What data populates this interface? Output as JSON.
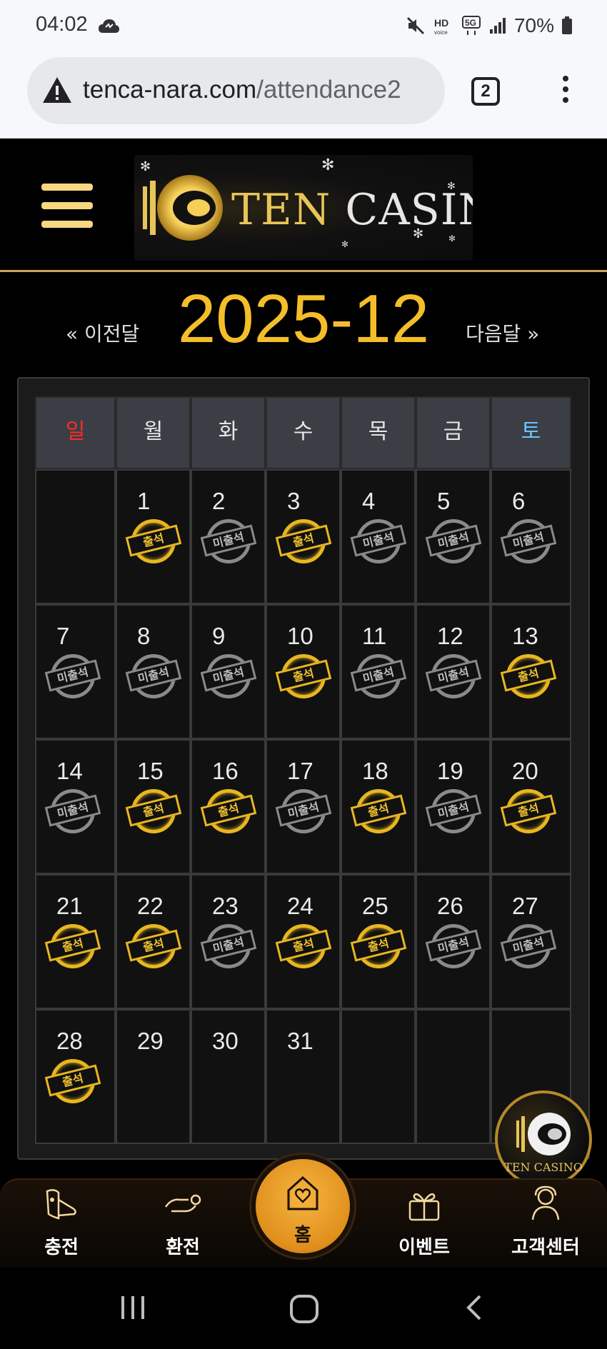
{
  "status_bar": {
    "time": "04:02",
    "battery": "70%",
    "icons": [
      "mute-icon",
      "hd-voice-icon",
      "5g-icon",
      "signal-icon",
      "battery-icon"
    ]
  },
  "browser": {
    "url_domain": "tenca-nara.com",
    "url_path": "/attendance2",
    "tab_count": "2"
  },
  "header": {
    "logo_ten": "TEN",
    "logo_casino": "CASINO"
  },
  "month_nav": {
    "prev_label": "« 이전달",
    "title": "2025-12",
    "next_label": "다음달 »"
  },
  "calendar": {
    "weekdays": [
      "일",
      "월",
      "화",
      "수",
      "목",
      "금",
      "토"
    ],
    "attend_label": "출석",
    "absent_label": "미출석",
    "weeks": [
      [
        {
          "day": "",
          "status": ""
        },
        {
          "day": "1",
          "status": "attend"
        },
        {
          "day": "2",
          "status": "absent"
        },
        {
          "day": "3",
          "status": "attend"
        },
        {
          "day": "4",
          "status": "absent"
        },
        {
          "day": "5",
          "status": "absent"
        },
        {
          "day": "6",
          "status": "absent"
        }
      ],
      [
        {
          "day": "7",
          "status": "absent"
        },
        {
          "day": "8",
          "status": "absent"
        },
        {
          "day": "9",
          "status": "absent"
        },
        {
          "day": "10",
          "status": "attend"
        },
        {
          "day": "11",
          "status": "absent"
        },
        {
          "day": "12",
          "status": "absent"
        },
        {
          "day": "13",
          "status": "attend"
        }
      ],
      [
        {
          "day": "14",
          "status": "absent"
        },
        {
          "day": "15",
          "status": "attend"
        },
        {
          "day": "16",
          "status": "attend"
        },
        {
          "day": "17",
          "status": "absent"
        },
        {
          "day": "18",
          "status": "attend"
        },
        {
          "day": "19",
          "status": "absent"
        },
        {
          "day": "20",
          "status": "attend"
        }
      ],
      [
        {
          "day": "21",
          "status": "attend"
        },
        {
          "day": "22",
          "status": "attend"
        },
        {
          "day": "23",
          "status": "absent"
        },
        {
          "day": "24",
          "status": "attend"
        },
        {
          "day": "25",
          "status": "attend"
        },
        {
          "day": "26",
          "status": "absent"
        },
        {
          "day": "27",
          "status": "absent"
        }
      ],
      [
        {
          "day": "28",
          "status": "attend"
        },
        {
          "day": "29",
          "status": ""
        },
        {
          "day": "30",
          "status": ""
        },
        {
          "day": "31",
          "status": ""
        },
        {
          "day": "",
          "status": ""
        },
        {
          "day": "",
          "status": ""
        },
        {
          "day": "",
          "status": ""
        }
      ]
    ]
  },
  "floating_logo": {
    "text": "TEN CASINO"
  },
  "bottom_nav": {
    "items": [
      {
        "label": "충전",
        "icon": "deposit-icon"
      },
      {
        "label": "환전",
        "icon": "withdraw-icon"
      },
      {
        "label": "홈",
        "icon": "home-icon"
      },
      {
        "label": "이벤트",
        "icon": "gift-icon"
      },
      {
        "label": "고객센터",
        "icon": "support-icon"
      }
    ]
  },
  "colors": {
    "accent_gold": "#f4be2a",
    "sunday_red": "#ff2a2a",
    "saturday_blue": "#6ac6ff"
  }
}
